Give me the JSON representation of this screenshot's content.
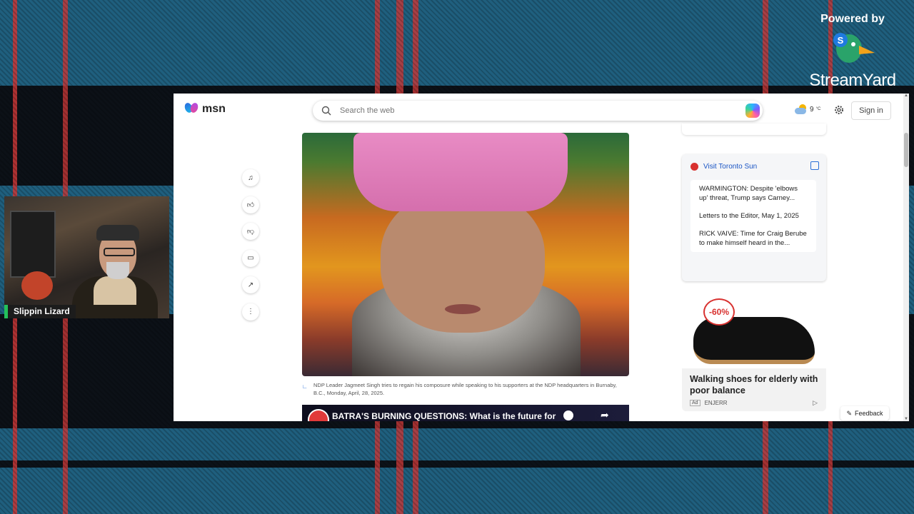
{
  "streamyard": {
    "powered_by": "Powered by",
    "brand": "StreamYard"
  },
  "camera": {
    "name": "Slippin Lizard"
  },
  "browser": {
    "logo_text": "msn",
    "search_placeholder": "Search the web",
    "weather_temp": "9",
    "weather_unit": "°C",
    "signin_label": "Sign in",
    "rail_icons": [
      "headphones-icon",
      "like-icon",
      "dislike-icon",
      "comment-icon",
      "share-icon",
      "more-icon"
    ],
    "hero_caption": "NDP Leader Jagmeet Singh tries to regain his composure while speaking to his supporters at the NDP headquarters in Burnaby, B.C., Monday, April, 28, 2025.",
    "video_title": "BATRA'S BURNING QUESTIONS: What is the future for",
    "sidebar_card": {
      "source": "Visit Toronto Sun",
      "items": [
        "WARMINGTON: Despite 'elbows up' threat, Trump says Carney...",
        "Letters to the Editor, May 1, 2025",
        "RICK VAIVE: Time for Craig Berube to make himself heard in the..."
      ]
    },
    "ad": {
      "badge": "-60%",
      "headline": "Walking shoes for elderly with poor balance",
      "tag": "Ad",
      "advertiser": "ENJERR"
    },
    "feedback_label": "Feedback"
  }
}
